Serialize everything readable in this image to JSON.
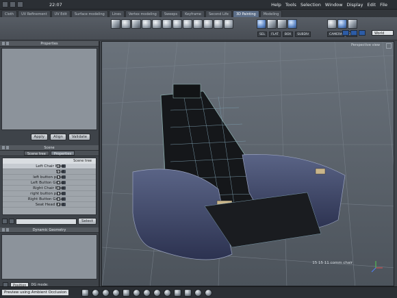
{
  "topbar": {
    "clock": "22:07",
    "menu": [
      "Help",
      "Tools",
      "Selection",
      "Window",
      "Display",
      "Edit",
      "File"
    ]
  },
  "tabs": [
    "Cloth",
    "UV Refinement",
    "UV Edit",
    "Surface modeling",
    "Lines",
    "Vertex modeling",
    "Sweeps",
    "Keyframe",
    "Second Life",
    "3D Painting",
    "Modeling"
  ],
  "active_tab_index": 9,
  "toolbar": {
    "labels_mid": [
      "SEL",
      "FLAT",
      "BOX",
      "SUBDIV"
    ],
    "labels_right": [
      "CAMERA",
      "DOF"
    ],
    "world_select": "World"
  },
  "left": {
    "properties_title": "Properties",
    "properties_buttons": [
      "Apply",
      "Align",
      "Validate"
    ],
    "scene_title": "Scene",
    "scene_tabs": [
      "Scene tree",
      "Properties"
    ],
    "scene_items": [
      "Left Chair Base",
      "Seat",
      "left button panel",
      "Left Button Group",
      "Right Chair Base",
      "right button panel",
      "Right Button Group",
      "Seat Head Rest"
    ],
    "select_button": "Select",
    "dynamic_title": "Dynamic Geometry",
    "dyn_mode_label": "DG mode:",
    "dyn_mode_value": "Position"
  },
  "viewport": {
    "label": "Perspective view",
    "stats": "15  15  11  comm chair"
  },
  "status": {
    "message": "Preview using Ambient Occlusion"
  }
}
